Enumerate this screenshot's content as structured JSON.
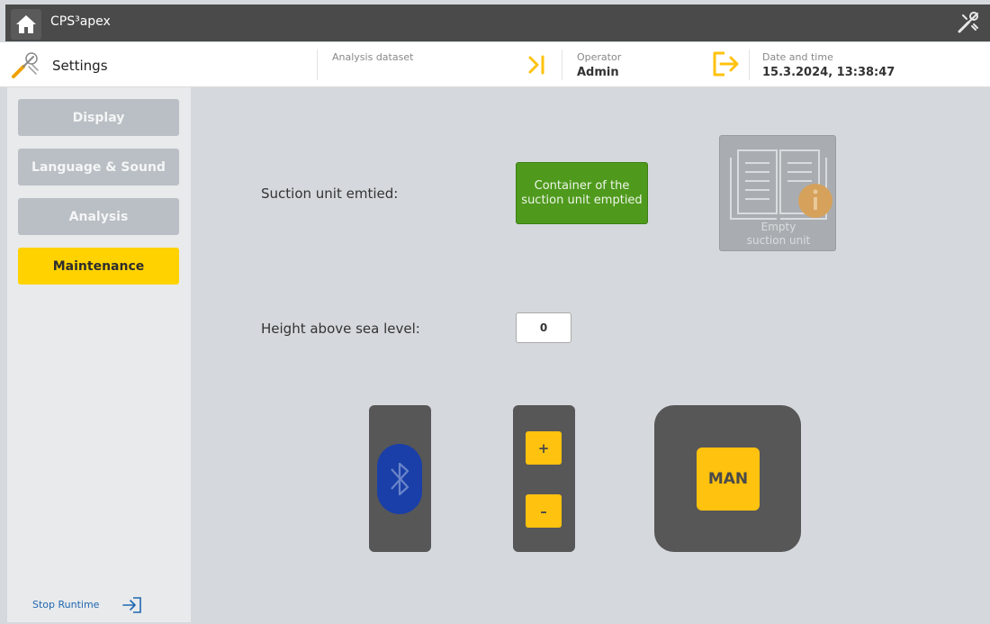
{
  "app": {
    "title": "CPS³apex"
  },
  "header": {
    "page_title": "Settings",
    "analysis_label": "Analysis dataset",
    "operator_label": "Operator",
    "operator_value": "Admin",
    "datetime_label": "Date and time",
    "datetime_value": "15.3.2024, 13:38:47"
  },
  "sidebar": {
    "items": [
      {
        "label": "Display"
      },
      {
        "label": "Language & Sound"
      },
      {
        "label": "Analysis"
      },
      {
        "label": "Maintenance"
      }
    ],
    "stop_runtime": "Stop Runtime"
  },
  "main": {
    "suction_label": "Suction unit emtied:",
    "container_btn_line1": "Container of the",
    "container_btn_line2": "suction unit emptied",
    "manual_line1": "Empty",
    "manual_line2": "suction unit",
    "height_label": "Height above sea level:",
    "height_value": "0",
    "plus_label": "+",
    "minus_label": "–",
    "man_label": "MAN"
  },
  "colors": {
    "accent_yellow": "#ffd200",
    "green": "#4f9a1d",
    "bluetooth_blue": "#1a3fa8",
    "dark_panel": "#575757"
  },
  "icons": [
    "home-icon",
    "tools-icon",
    "settings-icon",
    "skip-to-end-icon",
    "logout-icon",
    "manual-icon",
    "info-icon",
    "bluetooth-icon",
    "stop-runtime-icon"
  ]
}
